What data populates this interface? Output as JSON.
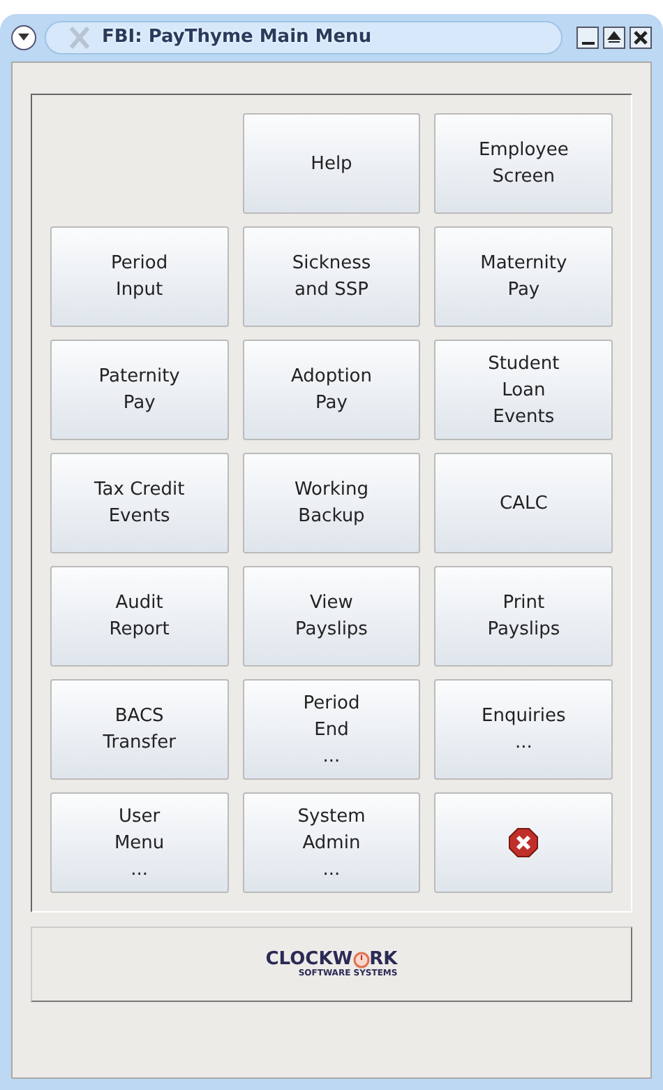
{
  "window": {
    "title": "FBI: PayThyme Main Menu"
  },
  "buttons": [
    {
      "kind": "empty"
    },
    {
      "kind": "text",
      "label": "Help"
    },
    {
      "kind": "text",
      "label": "Employee\nScreen"
    },
    {
      "kind": "text",
      "label": "Period\nInput"
    },
    {
      "kind": "text",
      "label": "Sickness\nand SSP"
    },
    {
      "kind": "text",
      "label": "Maternity\nPay"
    },
    {
      "kind": "text",
      "label": "Paternity\nPay"
    },
    {
      "kind": "text",
      "label": "Adoption\nPay"
    },
    {
      "kind": "text",
      "label": "Student\nLoan\nEvents"
    },
    {
      "kind": "text",
      "label": "Tax Credit\nEvents"
    },
    {
      "kind": "text",
      "label": "Working\nBackup"
    },
    {
      "kind": "text",
      "label": "CALC"
    },
    {
      "kind": "text",
      "label": "Audit\nReport"
    },
    {
      "kind": "text",
      "label": "View\nPayslips"
    },
    {
      "kind": "text",
      "label": "Print\nPayslips"
    },
    {
      "kind": "text",
      "label": "BACS\nTransfer"
    },
    {
      "kind": "text",
      "label": "Period\nEnd\n..."
    },
    {
      "kind": "text",
      "label": "Enquiries\n..."
    },
    {
      "kind": "text",
      "label": "User\nMenu\n..."
    },
    {
      "kind": "text",
      "label": "System\nAdmin\n..."
    },
    {
      "kind": "close"
    }
  ],
  "logo": {
    "before": "CLOCKW",
    "after": "RK",
    "tagline": "SOFTWARE SYSTEMS"
  }
}
